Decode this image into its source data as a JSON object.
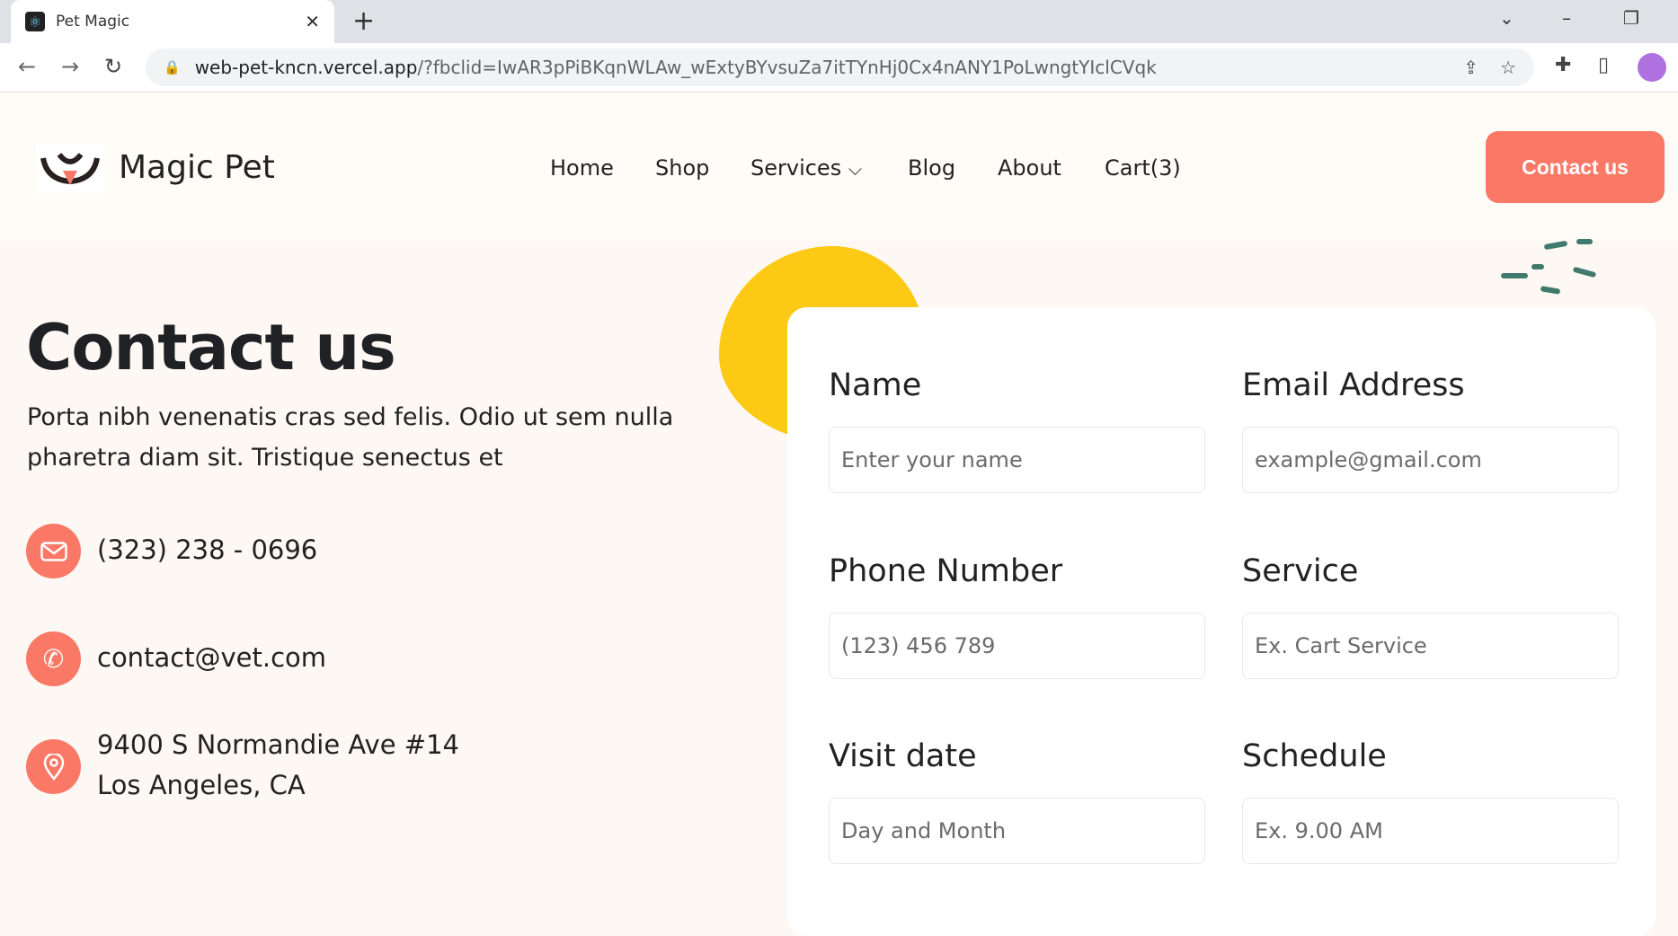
{
  "browser": {
    "tab_title": "Pet Magic",
    "url_host": "web-pet-kncn.vercel.app",
    "url_rest": "/?fbclid=IwAR3pPiBKqnWLAw_wExtyBYvsuZa7itTYnHj0Cx4nANY1PoLwngtYIclCVqk"
  },
  "header": {
    "brand": "Magic Pet",
    "nav": [
      "Home",
      "Shop",
      "Services",
      "Blog",
      "About",
      "Cart(3)"
    ],
    "cta": "Contact us",
    "accent": "#fa7866"
  },
  "hero": {
    "title": "Contact us",
    "intro": "Porta nibh venenatis cras sed felis. Odio ut sem nulla pharetra diam sit. Tristique senectus et"
  },
  "contacts": {
    "phone": "(323) 238 - 0696",
    "email": "contact@vet.com",
    "address_line1": "9400 S Normandie Ave #14",
    "address_line2": "Los Angeles, CA"
  },
  "form": {
    "name": {
      "label": "Name",
      "placeholder": "Enter your name"
    },
    "email": {
      "label": "Email Address",
      "placeholder": "example@gmail.com"
    },
    "phone": {
      "label": "Phone Number",
      "placeholder": "(123) 456 789"
    },
    "service": {
      "label": "Service",
      "placeholder": "Ex. Cart Service"
    },
    "date": {
      "label": "Visit date",
      "placeholder": "Day and Month"
    },
    "schedule": {
      "label": "Schedule",
      "placeholder": "Ex. 9.00 AM"
    }
  }
}
